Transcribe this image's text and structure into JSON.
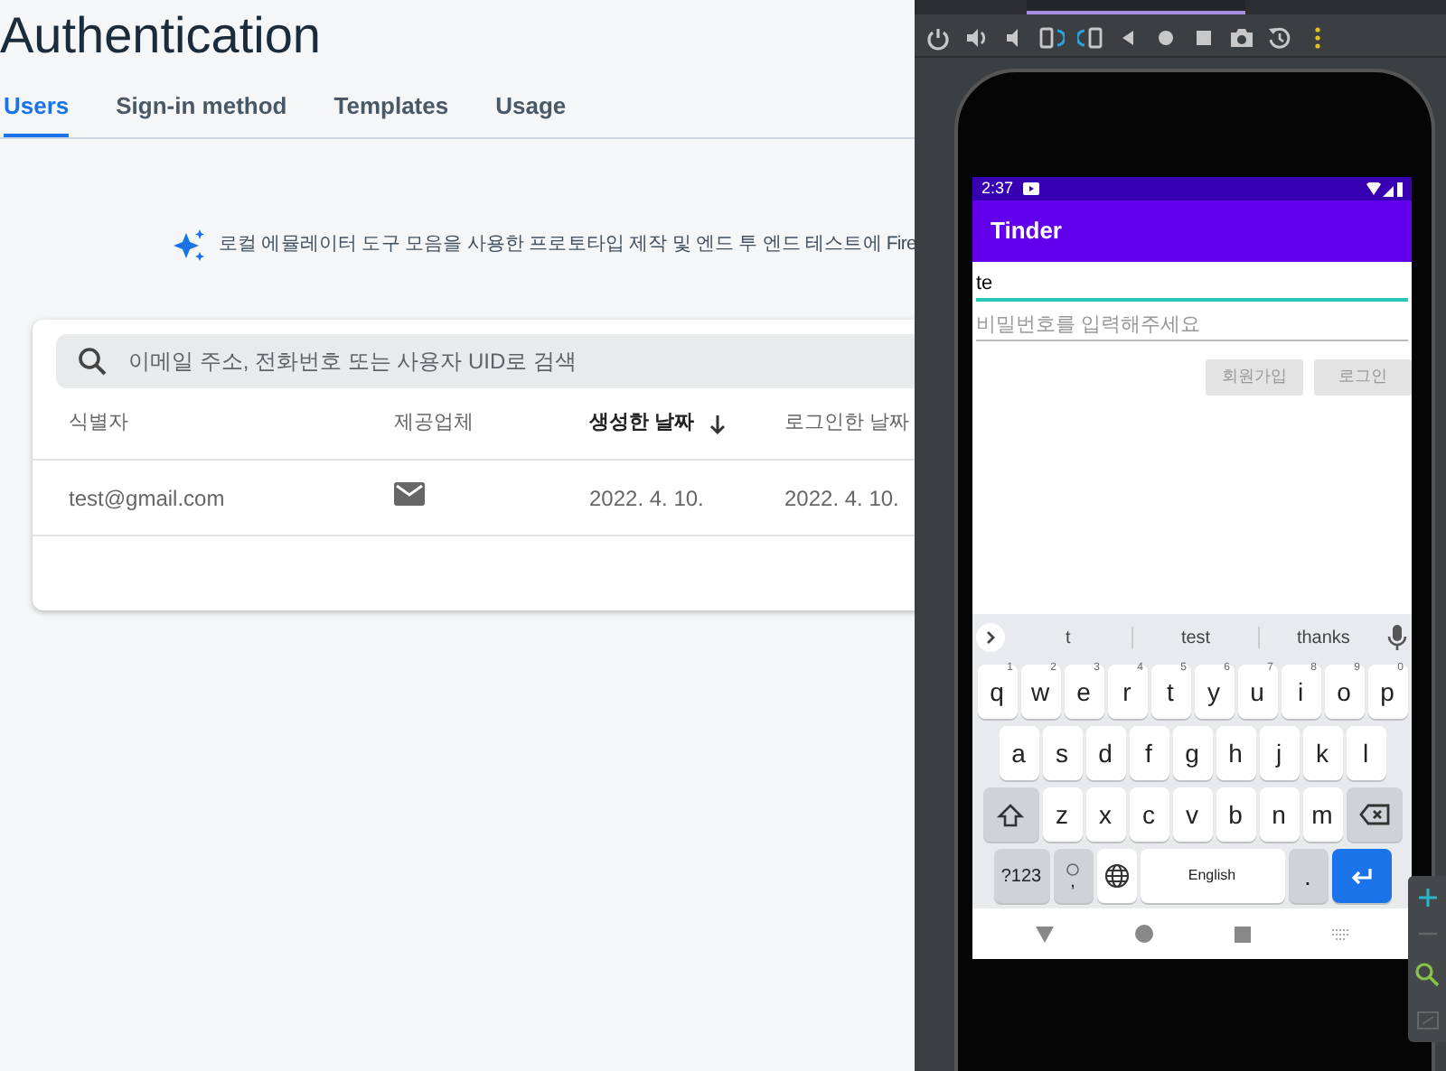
{
  "console": {
    "title": "Authentication",
    "tabs": [
      {
        "label": "Users",
        "selected": true
      },
      {
        "label": "Sign-in method",
        "selected": false
      },
      {
        "label": "Templates",
        "selected": false
      },
      {
        "label": "Usage",
        "selected": false
      }
    ],
    "banner": "로컬 에뮬레이터 도구 모음을 사용한 프로토타입 제작 및 엔드 투 엔드 테스트에 Fire",
    "search": {
      "placeholder": "이메일 주소, 전화번호 또는 사용자 UID로 검색"
    },
    "columns": [
      {
        "label": "식별자",
        "sorted": false
      },
      {
        "label": "제공업체",
        "sorted": false
      },
      {
        "label": "생성한 날짜",
        "sorted": true
      },
      {
        "label": "로그인한 날짜",
        "sorted": false
      }
    ],
    "rows": [
      {
        "identifier": "test@gmail.com",
        "created": "2022. 4. 10.",
        "signed_in": "2022. 4. 10."
      }
    ]
  },
  "phone": {
    "time": "2:37",
    "app_title": "Tinder",
    "fields": [
      {
        "value": "te",
        "focused": true
      },
      {
        "placeholder": "비밀번호를 입력해주세요",
        "focused": false
      }
    ],
    "buttons": [
      "회원가입",
      "로그인"
    ],
    "suggestions": [
      "t",
      "test",
      "thanks"
    ],
    "keyboard": [
      [
        {
          "kind": "letter",
          "label": "q",
          "hint": "1"
        },
        {
          "kind": "letter",
          "label": "w",
          "hint": "2"
        },
        {
          "kind": "letter",
          "label": "e",
          "hint": "3"
        },
        {
          "kind": "letter",
          "label": "r",
          "hint": "4"
        },
        {
          "kind": "letter",
          "label": "t",
          "hint": "5"
        },
        {
          "kind": "letter",
          "label": "y",
          "hint": "6"
        },
        {
          "kind": "letter",
          "label": "u",
          "hint": "7"
        },
        {
          "kind": "letter",
          "label": "i",
          "hint": "8"
        },
        {
          "kind": "letter",
          "label": "o",
          "hint": "9"
        },
        {
          "kind": "letter",
          "label": "p",
          "hint": "0"
        }
      ],
      [
        {
          "kind": "letter",
          "label": "a"
        },
        {
          "kind": "letter",
          "label": "s"
        },
        {
          "kind": "letter",
          "label": "d"
        },
        {
          "kind": "letter",
          "label": "f"
        },
        {
          "kind": "letter",
          "label": "g"
        },
        {
          "kind": "letter",
          "label": "h"
        },
        {
          "kind": "letter",
          "label": "j"
        },
        {
          "kind": "letter",
          "label": "k"
        },
        {
          "kind": "letter",
          "label": "l"
        }
      ],
      [
        {
          "kind": "shift"
        },
        {
          "kind": "letter",
          "label": "z"
        },
        {
          "kind": "letter",
          "label": "x"
        },
        {
          "kind": "letter",
          "label": "c"
        },
        {
          "kind": "letter",
          "label": "v"
        },
        {
          "kind": "letter",
          "label": "b"
        },
        {
          "kind": "letter",
          "label": "n"
        },
        {
          "kind": "letter",
          "label": "m"
        },
        {
          "kind": "backspace"
        }
      ],
      [
        {
          "kind": "symbols",
          "label": "?123"
        },
        {
          "kind": "emoji",
          "label": ","
        },
        {
          "kind": "globe"
        },
        {
          "kind": "space",
          "label": "English"
        },
        {
          "kind": "period",
          "label": "."
        },
        {
          "kind": "enter"
        }
      ]
    ]
  }
}
